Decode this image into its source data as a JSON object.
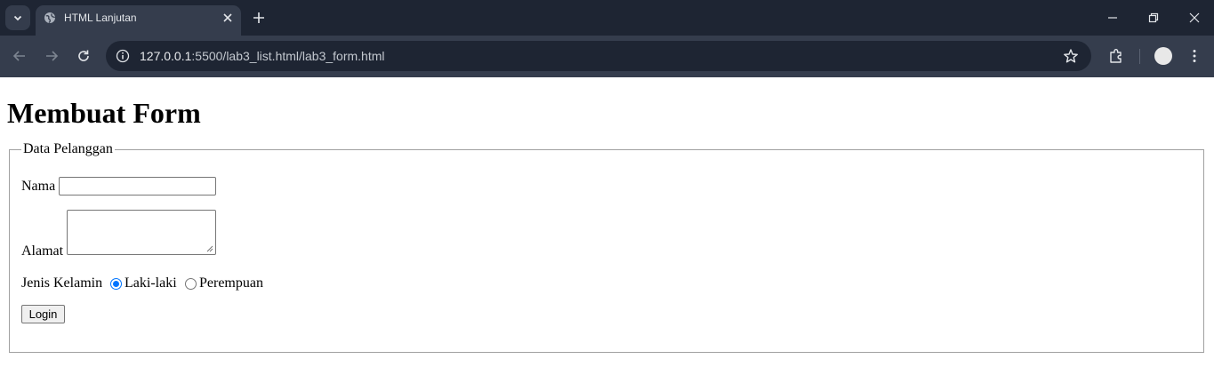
{
  "browser": {
    "tab": {
      "title": "HTML Lanjutan"
    },
    "address": {
      "host": "127.0.0.1",
      "path": ":5500/lab3_list.html/lab3_form.html"
    }
  },
  "page": {
    "heading": "Membuat Form",
    "form": {
      "legend": "Data Pelanggan",
      "nama_label": "Nama",
      "nama_value": "",
      "alamat_label": "Alamat",
      "alamat_value": "",
      "gender_label": "Jenis Kelamin",
      "gender_options": [
        {
          "label": "Laki-laki",
          "checked": true
        },
        {
          "label": "Perempuan",
          "checked": false
        }
      ],
      "submit_label": "Login"
    }
  },
  "colors": {
    "chrome_dark": "#1e2533",
    "chrome_mid": "#353d4d",
    "radio_accent": "#0075ff"
  }
}
